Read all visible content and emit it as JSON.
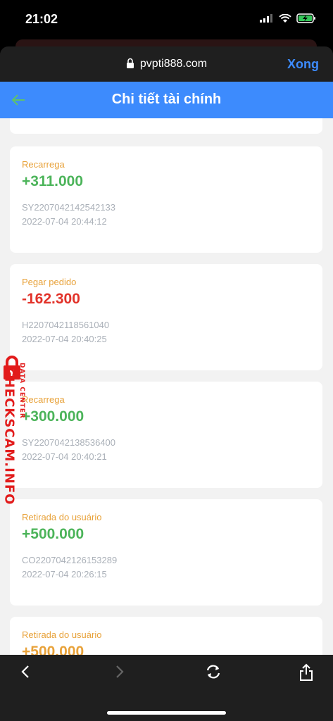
{
  "status_bar": {
    "time": "21:02"
  },
  "browser": {
    "url": "pvpti888.com",
    "done_label": "Xong"
  },
  "header": {
    "title": "Chi tiết tài chính"
  },
  "transactions": [
    {
      "type": "Recarrega",
      "amount": "+311.000",
      "code": "SY2207042142542133",
      "date": "2022-07-04 20:44:12"
    },
    {
      "type": "Pegar pedido",
      "amount": "-162.300",
      "code": "H2207042118561040",
      "date": "2022-07-04 20:40:25"
    },
    {
      "type": "Recarrega",
      "amount": "+300.000",
      "code": "SY2207042138536400",
      "date": "2022-07-04 20:40:21"
    },
    {
      "type": "Retirada do usuário",
      "amount": "+500.000",
      "code": "CO2207042126153289",
      "date": "2022-07-04 20:26:15"
    },
    {
      "type": "Retirada do usuário",
      "amount": "+500.000"
    }
  ],
  "watermark": {
    "main": "CHECKSCAM.INFO",
    "sub": "DATA CENTER"
  },
  "colors": {
    "accent": "#3d8bfd",
    "positive": "#4cb45a",
    "negative": "#e2332a",
    "type_label": "#e8a23a",
    "partial_amount": "#e8a23a"
  }
}
